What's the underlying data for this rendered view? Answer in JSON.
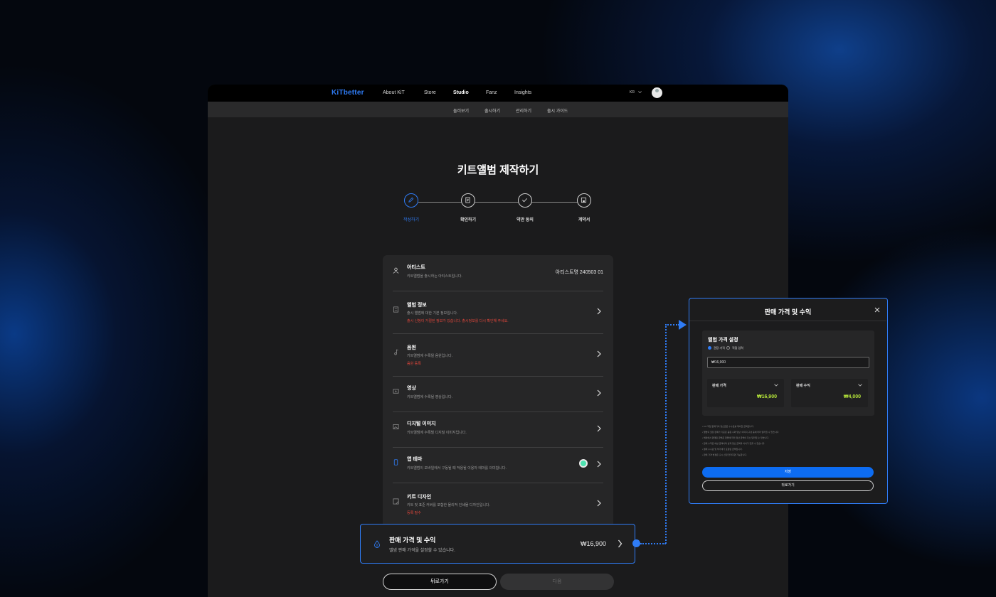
{
  "nav": {
    "logo": "KiTbetter",
    "items": [
      "About KiT",
      "Store",
      "Studio",
      "Fanz",
      "Insights"
    ],
    "lang": "KR"
  },
  "subnav": {
    "items": [
      "둘러보기",
      "출시하기",
      "관리하기",
      "출시 가이드"
    ]
  },
  "page": {
    "title": "키트앨범 제작하기"
  },
  "steps": [
    "작성하기",
    "확인하기",
    "약관 동의",
    "계약서"
  ],
  "sections": [
    {
      "title": "아티스트",
      "desc": "키트앨범을 출시하는 아티스트입니다.",
      "value": "아티스트명 240503 01"
    },
    {
      "title": "앨범 정보",
      "desc": "출시 앨범에 대한 기본 정보입니다.",
      "warning": "출시 신청이 거절된 정보가 있습니다. 출시정보를 다시 확인해 주세요."
    },
    {
      "title": "음원",
      "desc": "키트앨범에 수록될 음원입니다.",
      "warning": "음원 등록"
    },
    {
      "title": "영상",
      "desc": "키트앨범에 수록될 영상입니다."
    },
    {
      "title": "디지털 이미지",
      "desc": "키트앨범에 수록될 디지털 이미지입니다."
    },
    {
      "title": "앱 테마",
      "desc": "키트앨범이 모바일에서 구동될 때 적용될 이용자 테마를 의미합니다."
    },
    {
      "title": "키트 디자인",
      "desc": "키트 및 표준 커버를 포함한 물리적 인쇄물 디자인입니다.",
      "warning": "등록 필수"
    }
  ],
  "highlight": {
    "title": "판매 가격 및 수익",
    "desc": "앨범 판매 가격을 설정할 수 있습니다.",
    "price": "₩16,900"
  },
  "buttons": {
    "back": "뒤로가기",
    "next": "다음"
  },
  "modal": {
    "title": "판매 가격 및 수익",
    "panel_title": "앨범 가격 설정",
    "radio_1": "권장 가격",
    "radio_2": "직접 입력",
    "input_value": "₩16,900",
    "box1_label": "판매 가격",
    "box1_value": "₩16,900",
    "box2_label": "판매 수익",
    "box2_value": "₩4,000",
    "notes": [
      "KiT 직접 판매가의 정산금은 수수료를 제외한 금액입니다.",
      "앨범의 권장 판매가 기준은 음원 수와 영상, 이미지 구성 등에 따라 달라질 수 있습니다.",
      "해외에서 판매된 금액은 환율에 따라 정산 금액이 다소 달라질 수 있습니다.",
      "판매 수익은 예상 금액이며 실제 정산 금액과 차이가 있을 수 있습니다.",
      "결제 수수료 및 부가세가 포함된 금액입니다.",
      "판매 가격 변경은 출시 신청 전까지만 가능합니다."
    ],
    "save": "저장",
    "back": "뒤로가기"
  },
  "colors": {
    "accent": "#2f7cf6",
    "highlight_value": "#b7e83a",
    "warning": "#e0463b"
  }
}
